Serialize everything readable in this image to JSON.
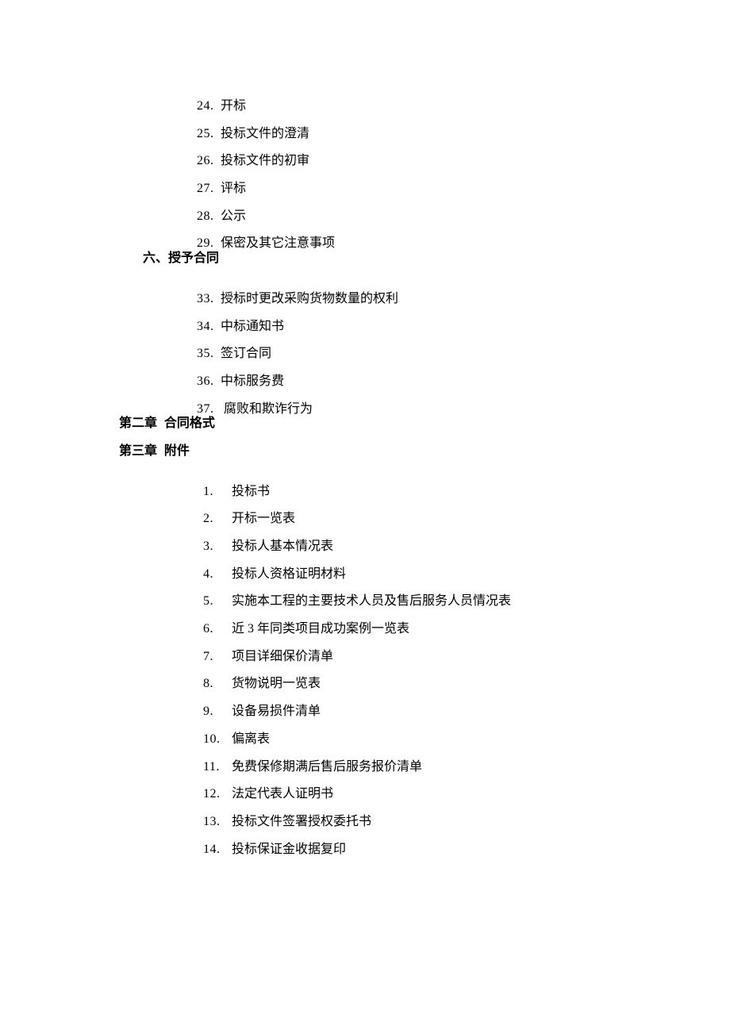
{
  "section5_items": [
    {
      "num": "24.",
      "text": "开标"
    },
    {
      "num": "25.",
      "text": "投标文件的澄清"
    },
    {
      "num": "26.",
      "text": "投标文件的初审"
    },
    {
      "num": "27.",
      "text": "评标"
    },
    {
      "num": "28.",
      "text": "公示"
    },
    {
      "num": "29.",
      "text": "保密及其它注意事项"
    }
  ],
  "section6_heading": "六、授予合同",
  "section6_items": [
    {
      "num": "33.",
      "text": "授标时更改采购货物数量的权利"
    },
    {
      "num": "34.",
      "text": "中标通知书"
    },
    {
      "num": "35.",
      "text": "签订合同"
    },
    {
      "num": "36.",
      "text": "中标服务费"
    },
    {
      "num": "37.",
      "text": " 腐败和欺诈行为"
    }
  ],
  "chapter2": "第二章  合同格式",
  "chapter3": "第三章  附件",
  "attachments": [
    {
      "num": "1.",
      "text": "投标书"
    },
    {
      "num": "2.",
      "text": "开标一览表"
    },
    {
      "num": "3.",
      "text": "投标人基本情况表"
    },
    {
      "num": "4.",
      "text": "投标人资格证明材料"
    },
    {
      "num": "5.",
      "text": "实施本工程的主要技术人员及售后服务人员情况表"
    },
    {
      "num": "6.",
      "text": "近 3 年同类项目成功案例一览表"
    },
    {
      "num": "7.",
      "text": "项目详细保价清单"
    },
    {
      "num": "8.",
      "text": "货物说明一览表"
    },
    {
      "num": "9.",
      "text": "设备易损件清单"
    },
    {
      "num": "10.",
      "text": "偏离表"
    },
    {
      "num": "11.",
      "text": "免费保修期满后售后服务报价清单"
    },
    {
      "num": "12.",
      "text": "法定代表人证明书"
    },
    {
      "num": "13.",
      "text": "投标文件签署授权委托书"
    },
    {
      "num": "14.",
      "text": "投标保证金收据复印"
    }
  ]
}
